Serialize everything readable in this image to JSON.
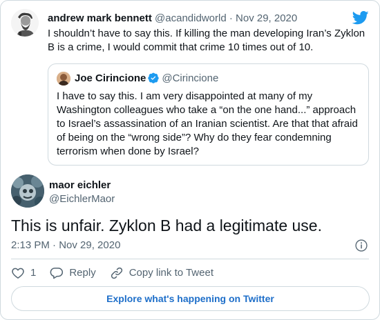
{
  "parent_tweet": {
    "author_name": "andrew mark bennett",
    "author_handle": "@acandidworld",
    "separator": " · ",
    "date": "Nov 29, 2020",
    "text": "I shouldn’t have to say this. If killing the man developing Iran’s Zyklon B is a crime, I would commit that crime 10 times out of 10."
  },
  "quoted_tweet": {
    "author_name": "Joe Cirincione",
    "author_handle": "@Cirincione",
    "verified": true,
    "text": "I have to say this. I am very disappointed at many of my Washington colleagues who take a “on the one hand...” approach to Israel’s assassination of an Iranian scientist. Are that that afraid of being on the “wrong side”? Why do they fear condemning terrorism when done by Israel?"
  },
  "main_tweet": {
    "author_name": "maor eichler",
    "author_handle": "@EichlerMaor",
    "text": "This is unfair. Zyklon B had a legitimate use.",
    "timestamp": "2:13 PM · Nov 29, 2020"
  },
  "actions": {
    "like_count": "1",
    "reply_label": "Reply",
    "copy_link_label": "Copy link to Tweet"
  },
  "explore_button": "Explore what's happening on Twitter",
  "colors": {
    "twitter_blue": "#1d9bf0",
    "link_blue": "#1d6ec9",
    "muted_text": "#536471",
    "border": "#cfd9de"
  },
  "icons": [
    "twitter-bird-icon",
    "verified-badge-icon",
    "info-icon",
    "heart-icon",
    "reply-icon",
    "link-icon"
  ]
}
